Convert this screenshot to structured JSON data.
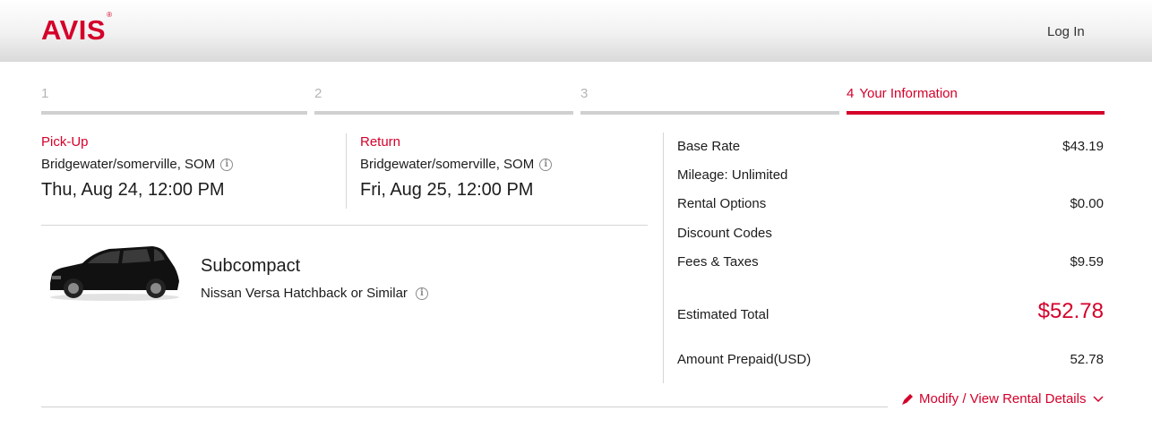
{
  "header": {
    "logo": "AVIS",
    "logo_mark": "®",
    "login": "Log In"
  },
  "steps": [
    {
      "num": "1",
      "label": ""
    },
    {
      "num": "2",
      "label": ""
    },
    {
      "num": "3",
      "label": ""
    },
    {
      "num": "4",
      "label": "Your Information"
    }
  ],
  "pickup": {
    "label": "Pick-Up",
    "location": "Bridgewater/somerville, SOM",
    "datetime": "Thu, Aug 24, 12:00 PM"
  },
  "return": {
    "label": "Return",
    "location": "Bridgewater/somerville, SOM",
    "datetime": "Fri, Aug 25, 12:00 PM"
  },
  "vehicle": {
    "class": "Subcompact",
    "model": "Nissan Versa Hatchback or Similar"
  },
  "summary": {
    "base_rate_label": "Base Rate",
    "base_rate_value": "$43.19",
    "mileage_label": "Mileage: Unlimited",
    "rental_options_label": "Rental Options",
    "rental_options_value": "$0.00",
    "discount_label": "Discount Codes",
    "fees_label": "Fees & Taxes",
    "fees_value": "$9.59",
    "total_label": "Estimated Total",
    "total_value": "$52.78",
    "prepaid_label": "Amount Prepaid(USD)",
    "prepaid_value": "52.78"
  },
  "modify_link": "Modify / View Rental Details",
  "icons": {
    "info": "info-icon",
    "edit": "pencil-icon",
    "chevron": "chevron-down-icon"
  },
  "colors": {
    "brand": "#d4002a",
    "step_inactive": "#d0d0d0"
  }
}
